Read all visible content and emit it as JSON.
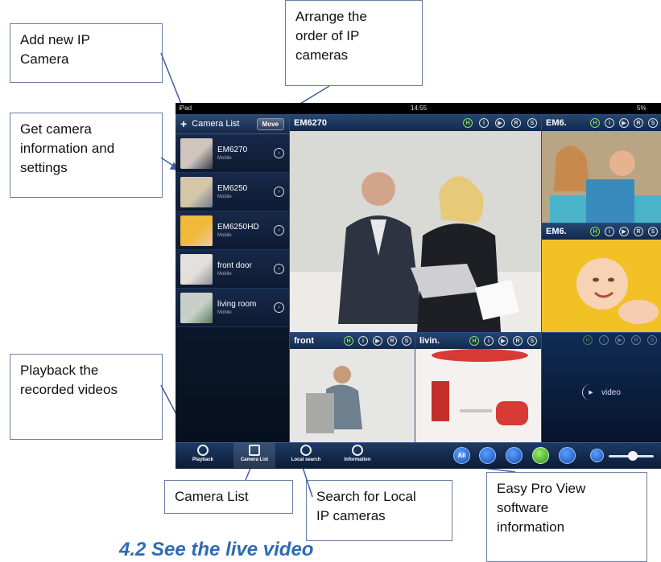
{
  "callouts": {
    "add_camera": "Add new IP\nCamera",
    "arrange": "Arrange the\norder of IP\ncameras",
    "info": "Get camera\ninformation and\nsettings",
    "playback": "Playback the\nrecorded videos",
    "camera_list": "Camera List",
    "local_search": "Search for Local\nIP cameras",
    "easy_pro": "Easy Pro View\nsoftware\ninformation"
  },
  "statusbar": {
    "left": "iPad",
    "time": "14:55",
    "battery": "5%"
  },
  "sidebar": {
    "add": "+",
    "title": "Camera List",
    "move": "Move",
    "cameras": [
      {
        "name": "EM6270",
        "type": "Mobile"
      },
      {
        "name": "EM6250",
        "type": "Mobile"
      },
      {
        "name": "EM6250HD",
        "type": "Mobile"
      },
      {
        "name": "front door",
        "type": "Mobile"
      },
      {
        "name": "living room",
        "type": "Mobile"
      }
    ]
  },
  "views": {
    "main": "EM6270",
    "top_right": "EM6.",
    "mid_right": "EM6.",
    "bottom_left": "front",
    "bottom_mid": "livin.",
    "video_label": "video"
  },
  "view_icons": [
    "H",
    "i",
    "▶",
    "R",
    "S"
  ],
  "toolbar": {
    "playback": "Playback",
    "camera_list": "Camera List",
    "local_search": "Local search",
    "information": "Information",
    "all": "All"
  },
  "heading": "4.2 See the live video"
}
